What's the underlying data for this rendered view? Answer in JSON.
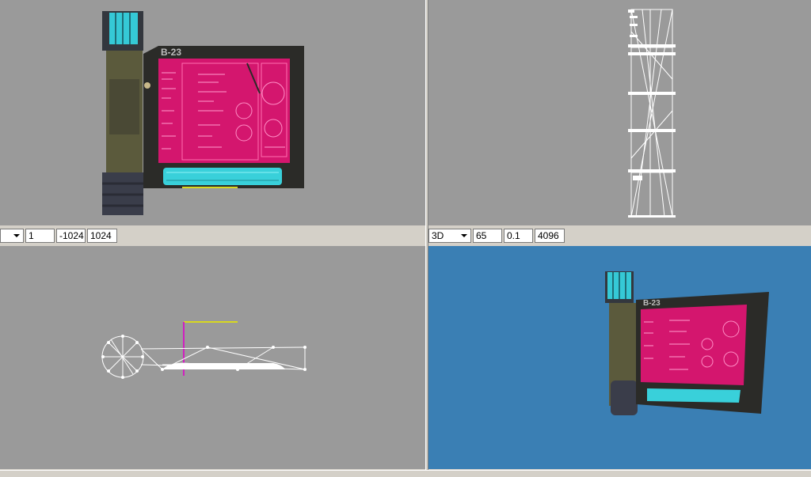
{
  "viewports": {
    "top_left": {
      "name": "texture-view",
      "label": "B-23"
    },
    "top_right": {
      "name": "wireframe-side-view"
    },
    "bottom_left": {
      "name": "wireframe-top-view"
    },
    "bottom_right": {
      "name": "3d-perspective-view",
      "label": "B-23"
    }
  },
  "left_controls": {
    "mode_value": "",
    "field1": "1",
    "field2": "-1024",
    "field3": "1024"
  },
  "right_controls": {
    "mode_value": "3D",
    "fov": "65",
    "near": "0.1",
    "far": "4096"
  },
  "colors": {
    "viewport_gray": "#9a9a9a",
    "viewport_blue": "#3a7fb4",
    "screen_magenta": "#d4166e",
    "glow_cyan": "#3fd6e0",
    "frame_dark": "#2b2b28"
  }
}
